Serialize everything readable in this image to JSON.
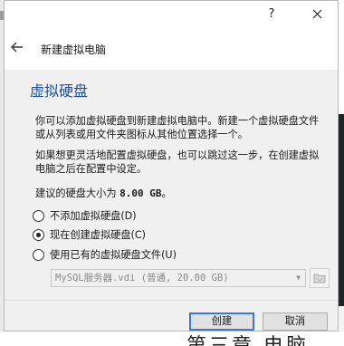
{
  "titlebar": {
    "help": "?",
    "close_icon": "close-icon"
  },
  "nav": {
    "back_icon": "arrow-left-icon",
    "title": "新建虚拟电脑"
  },
  "page": {
    "heading": "虚拟硬盘",
    "intro": "你可以添加虚拟硬盘到新建虚拟电脑中。新建一个虚拟硬盘文件或从列表或用文件夹图标从其他位置选择一个。",
    "advanced": "如果想更灵活地配置虚拟硬盘，也可以跳过这一步，在创建虚拟电脑之后在配置中设定。",
    "size_prefix": "建议的硬盘大小为",
    "size_value": "8.00 GB",
    "size_suffix": "。"
  },
  "options": [
    {
      "label": "不添加虚拟硬盘(D)",
      "checked": false
    },
    {
      "label": "现在创建虚拟硬盘(C)",
      "checked": true
    },
    {
      "label": "使用已有的虚拟硬盘文件(U)",
      "checked": false
    }
  ],
  "existing_file": {
    "value": "MySQL服务器.vdi (普通, 20.00 GB)",
    "disabled": true,
    "folder_icon": "folder-icon"
  },
  "buttons": {
    "create": "创建",
    "cancel": "取消"
  },
  "background": {
    "bottom_text": "第三章 电脑"
  },
  "colors": {
    "heading": "#1f4e99",
    "default_button_border": "#3b78d6",
    "dialog_bg": "#f0f0f0"
  }
}
